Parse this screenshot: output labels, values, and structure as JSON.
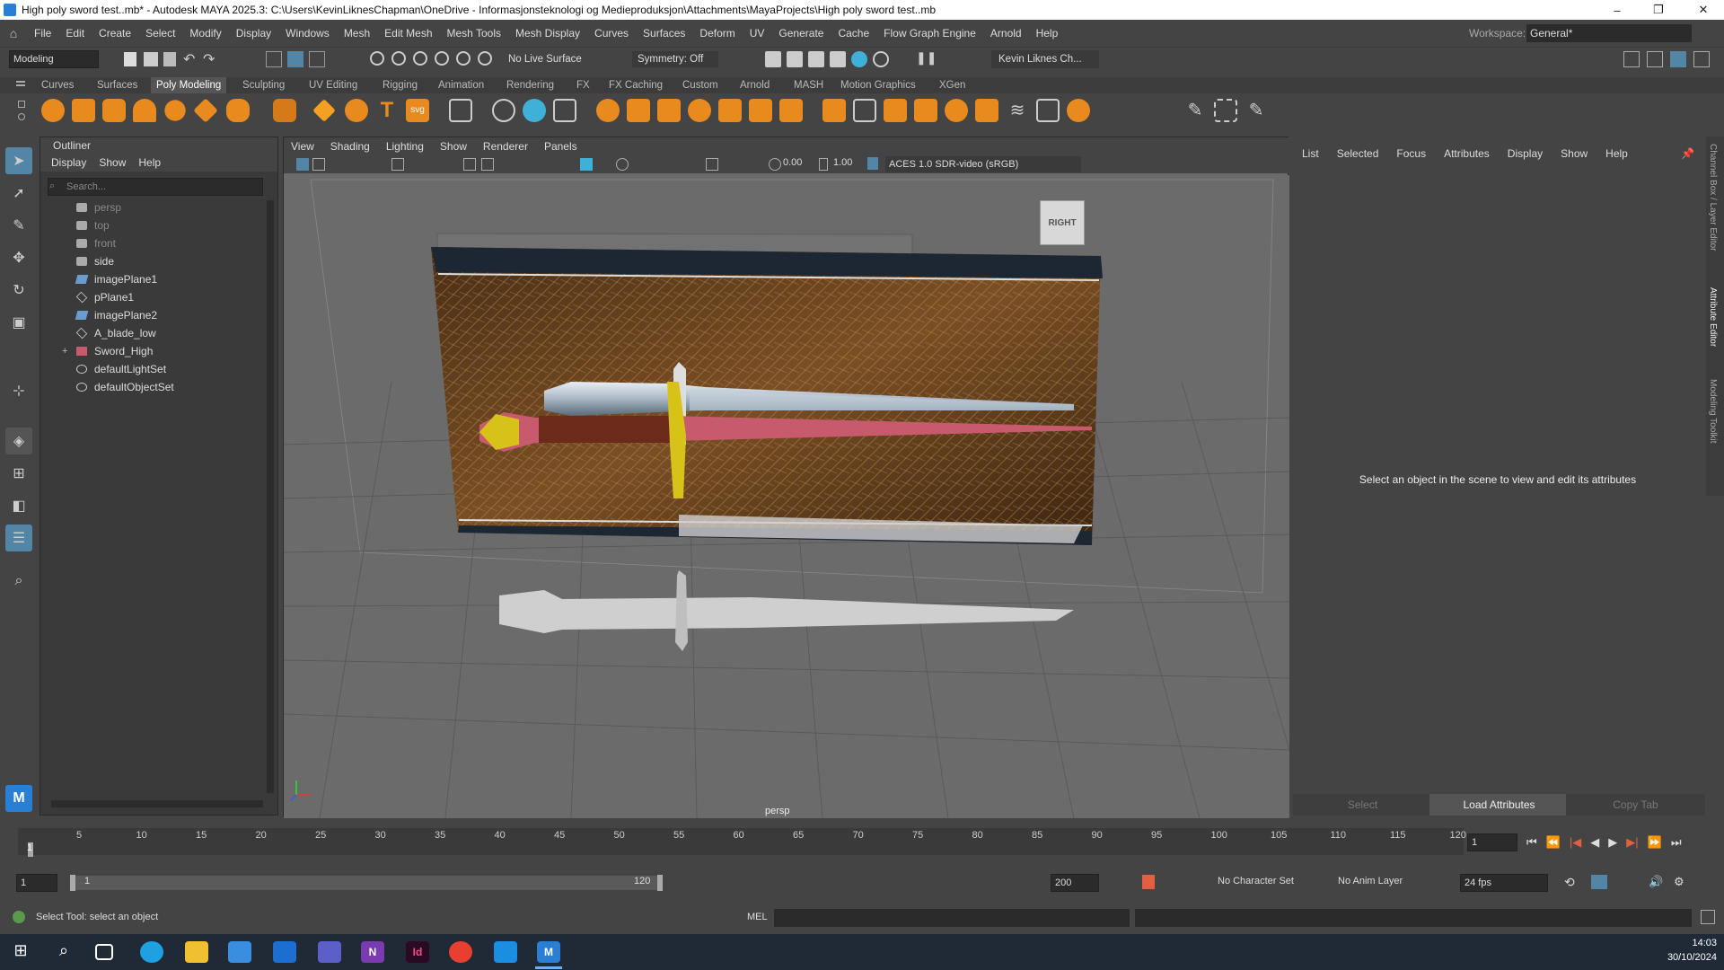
{
  "window": {
    "title": "High poly sword test..mb* - Autodesk MAYA 2025.3: C:\\Users\\KevinLiknesChapman\\OneDrive - Informasjonsteknologi og Medieproduksjon\\Attachments\\MayaProjects\\High poly sword test..mb",
    "minimize": "–",
    "maximize": "❐",
    "close": "✕"
  },
  "menubar": {
    "items": [
      "File",
      "Edit",
      "Create",
      "Select",
      "Modify",
      "Display",
      "Windows",
      "Mesh",
      "Edit Mesh",
      "Mesh Tools",
      "Mesh Display",
      "Curves",
      "Surfaces",
      "Deform",
      "UV",
      "Generate",
      "Cache",
      "Flow Graph Engine",
      "Arnold",
      "Help"
    ],
    "workspace_label": "Workspace:",
    "workspace_value": "General*"
  },
  "statusline": {
    "mode": "Modeling",
    "live_surface": "No Live Surface",
    "symmetry": "Symmetry: Off",
    "user": "Kevin Liknes Ch..."
  },
  "shelf": {
    "tabs": [
      "Curves",
      "Surfaces",
      "Poly Modeling",
      "Sculpting",
      "UV Editing",
      "Rigging",
      "Animation",
      "Rendering",
      "FX",
      "FX Caching",
      "Custom",
      "Arnold",
      "MASH",
      "Motion Graphics",
      "XGen"
    ],
    "active_tab": "Poly Modeling",
    "text_icons": {
      "type": "T",
      "svg": "svg"
    }
  },
  "outliner": {
    "title": "Outliner",
    "menu": [
      "Display",
      "Show",
      "Help"
    ],
    "search_placeholder": "Search...",
    "items": [
      {
        "label": "persp",
        "icon": "camera-icon",
        "dim": true
      },
      {
        "label": "top",
        "icon": "camera-icon",
        "dim": true
      },
      {
        "label": "front",
        "icon": "camera-icon",
        "dim": true
      },
      {
        "label": "side",
        "icon": "camera-icon",
        "dim": false
      },
      {
        "label": "imagePlane1",
        "icon": "image-plane-icon",
        "dim": false
      },
      {
        "label": "pPlane1",
        "icon": "mesh-icon",
        "dim": false
      },
      {
        "label": "imagePlane2",
        "icon": "image-plane-icon",
        "dim": false
      },
      {
        "label": "A_blade_low",
        "icon": "mesh-icon",
        "dim": false
      },
      {
        "label": "Sword_High",
        "icon": "group-icon",
        "dim": false,
        "expand": "+"
      },
      {
        "label": "defaultLightSet",
        "icon": "set-icon",
        "dim": false
      },
      {
        "label": "defaultObjectSet",
        "icon": "set-icon",
        "dim": false
      }
    ]
  },
  "viewport": {
    "menu": [
      "View",
      "Shading",
      "Lighting",
      "Show",
      "Renderer",
      "Panels"
    ],
    "exposure": "0.00",
    "gamma": "1.00",
    "color_space": "ACES 1.0 SDR-video (sRGB)",
    "camera_label": "persp",
    "viewcube_label": "RIGHT"
  },
  "attribute_editor": {
    "menu": [
      "List",
      "Selected",
      "Focus",
      "Attributes",
      "Display",
      "Show",
      "Help"
    ],
    "message": "Select an object in the scene to view and edit its attributes",
    "buttons": [
      "Select",
      "Load Attributes",
      "Copy Tab"
    ]
  },
  "side_tabs": [
    "Channel Box / Layer Editor",
    "Attribute Editor",
    "Modeling Toolkit"
  ],
  "timeline": {
    "ticks": [
      "5",
      "10",
      "15",
      "20",
      "25",
      "30",
      "35",
      "40",
      "45",
      "50",
      "55",
      "60",
      "65",
      "70",
      "75",
      "80",
      "85",
      "90",
      "95",
      "100",
      "105",
      "110",
      "115",
      "120"
    ],
    "first_frame": "1",
    "current_frame": "1"
  },
  "range": {
    "start": "1",
    "range_start": "1",
    "range_end": "120",
    "end": "200",
    "character_set": "No Character Set",
    "anim_layer": "No Anim Layer",
    "fps": "24 fps"
  },
  "command": {
    "help": "Select Tool: select an object",
    "lang": "MEL"
  },
  "taskbar": {
    "time": "14:03",
    "date": "30/10/2024",
    "app_icons": [
      "windows-icon",
      "search-icon",
      "task-view-icon",
      "edge-icon",
      "file-explorer-icon",
      "store-icon",
      "outlook-icon",
      "teams-icon",
      "onenote-icon",
      "indesign-icon",
      "chrome-icon",
      "photos-icon",
      "maya-icon"
    ],
    "app_labels": {
      "onenote": "N",
      "indesign": "Id",
      "maya": "M"
    }
  },
  "colors": {
    "accent": "#5285a6",
    "maya_bg": "#444444",
    "viewport_bg": "#6b6b6b",
    "sword_blade_low": "#c85a6e",
    "sword_guard": "#d7c21a"
  }
}
